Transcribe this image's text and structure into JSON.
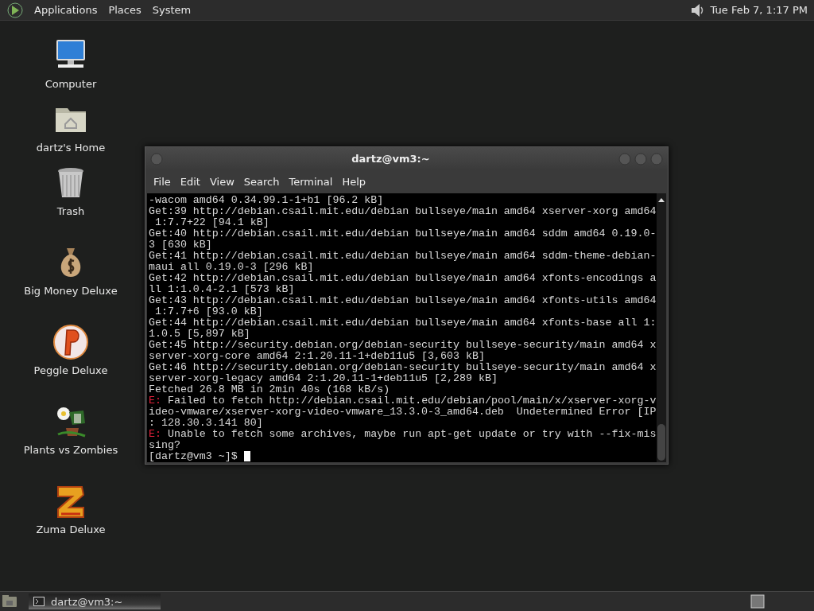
{
  "top_panel": {
    "menus": [
      "Applications",
      "Places",
      "System"
    ],
    "clock": "Tue Feb  7, 1:17 PM"
  },
  "desktop_icons": [
    {
      "kind": "computer",
      "label": "Computer"
    },
    {
      "kind": "home",
      "label": "dartz's Home"
    },
    {
      "kind": "trash",
      "label": "Trash"
    },
    {
      "kind": "moneybag",
      "label": "Big Money Deluxe"
    },
    {
      "kind": "peggle",
      "label": "Peggle Deluxe"
    },
    {
      "kind": "plants",
      "label": "Plants vs Zombies"
    },
    {
      "kind": "zuma",
      "label": "Zuma Deluxe"
    }
  ],
  "terminal": {
    "title": "dartz@vm3:~",
    "menu": [
      "File",
      "Edit",
      "View",
      "Search",
      "Terminal",
      "Help"
    ],
    "lines": [
      {
        "kind": "output",
        "text": "-wacom amd64 0.34.99.1-1+b1 [96.2 kB]"
      },
      {
        "kind": "output",
        "text": "Get:39 http://debian.csail.mit.edu/debian bullseye/main amd64 xserver-xorg amd64"
      },
      {
        "kind": "output",
        "text": " 1:7.7+22 [94.1 kB]"
      },
      {
        "kind": "output",
        "text": "Get:40 http://debian.csail.mit.edu/debian bullseye/main amd64 sddm amd64 0.19.0-"
      },
      {
        "kind": "output",
        "text": "3 [630 kB]"
      },
      {
        "kind": "output",
        "text": "Get:41 http://debian.csail.mit.edu/debian bullseye/main amd64 sddm-theme-debian-"
      },
      {
        "kind": "output",
        "text": "maui all 0.19.0-3 [296 kB]"
      },
      {
        "kind": "output",
        "text": "Get:42 http://debian.csail.mit.edu/debian bullseye/main amd64 xfonts-encodings a"
      },
      {
        "kind": "output",
        "text": "ll 1:1.0.4-2.1 [573 kB]"
      },
      {
        "kind": "output",
        "text": "Get:43 http://debian.csail.mit.edu/debian bullseye/main amd64 xfonts-utils amd64"
      },
      {
        "kind": "output",
        "text": " 1:7.7+6 [93.0 kB]"
      },
      {
        "kind": "output",
        "text": "Get:44 http://debian.csail.mit.edu/debian bullseye/main amd64 xfonts-base all 1:"
      },
      {
        "kind": "output",
        "text": "1.0.5 [5,897 kB]"
      },
      {
        "kind": "output",
        "text": "Get:45 http://security.debian.org/debian-security bullseye-security/main amd64 x"
      },
      {
        "kind": "output",
        "text": "server-xorg-core amd64 2:1.20.11-1+deb11u5 [3,603 kB]"
      },
      {
        "kind": "output",
        "text": "Get:46 http://security.debian.org/debian-security bullseye-security/main amd64 x"
      },
      {
        "kind": "output",
        "text": "server-xorg-legacy amd64 2:1.20.11-1+deb11u5 [2,289 kB]"
      },
      {
        "kind": "output",
        "text": "Fetched 26.8 MB in 2min 40s (168 kB/s)"
      },
      {
        "kind": "error",
        "prefix": "E:",
        "text": " Failed to fetch http://debian.csail.mit.edu/debian/pool/main/x/xserver-xorg-v"
      },
      {
        "kind": "output",
        "text": "ideo-vmware/xserver-xorg-video-vmware_13.3.0-3_amd64.deb  Undetermined Error [IP"
      },
      {
        "kind": "output",
        "text": ": 128.30.3.141 80]"
      },
      {
        "kind": "error",
        "prefix": "E:",
        "text": " Unable to fetch some archives, maybe run apt-get update or try with --fix-mis"
      },
      {
        "kind": "output",
        "text": "sing?"
      },
      {
        "kind": "prompt",
        "text": "[dartz@vm3 ~]$ "
      }
    ]
  },
  "bottom_panel": {
    "tasks": [
      {
        "label": "dartz@vm3:~",
        "selected": true
      }
    ]
  }
}
